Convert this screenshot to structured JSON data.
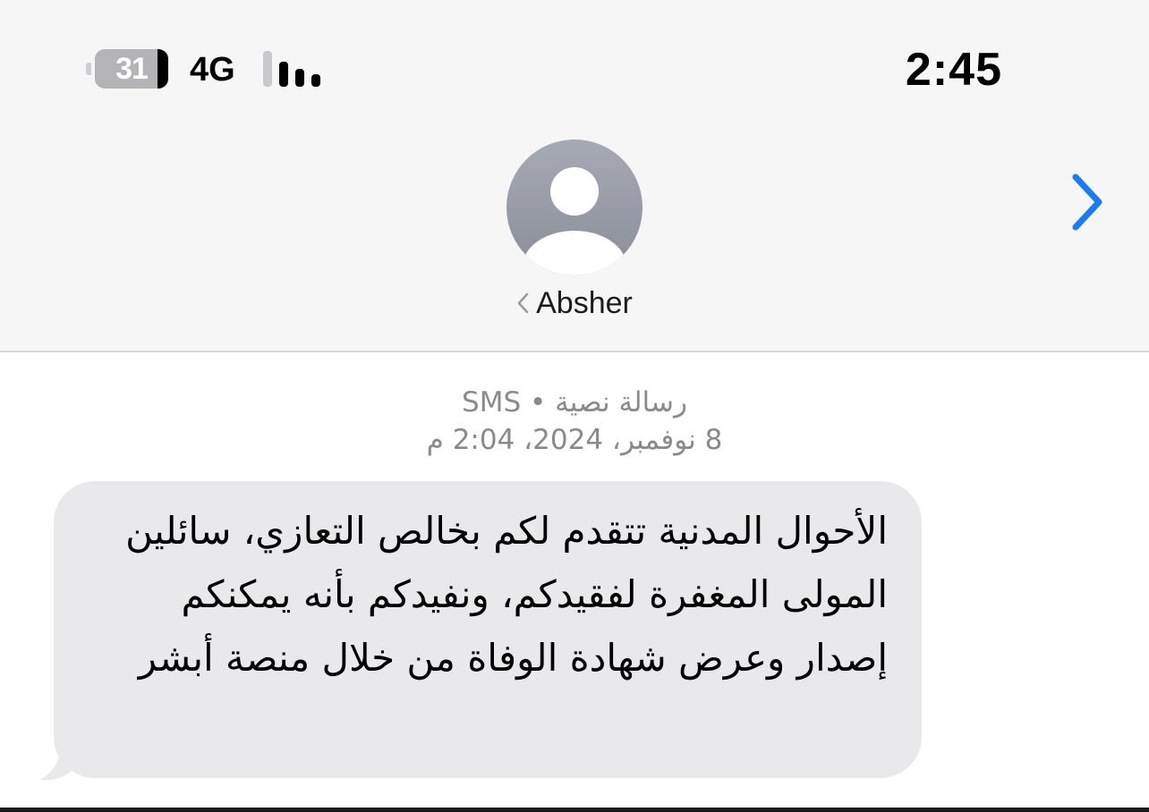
{
  "status_bar": {
    "battery_level": "31",
    "battery_fraction": 0.31,
    "network": "4G",
    "signal_bars_active": 3,
    "signal_bars_total": 4,
    "time": "2:45"
  },
  "header": {
    "contact_name": "Absher",
    "avatar_icon": "person-silhouette-icon",
    "details_icon": "chevron-right-icon",
    "back_icon": "chevron-left-icon"
  },
  "thread": {
    "message_type": "رسالة نصية • SMS",
    "timestamp": "8 نوفمبر، 2024، 2:04 م",
    "messages": [
      {
        "direction": "incoming",
        "text": "الأحوال المدنية تتقدم لكم بخالص التعازي، سائلين المولى المغفرة لفقيدكم، ونفيدكم بأنه يمكنكم إصدار وعرض شهادة الوفاة من خلال منصة أبشر"
      }
    ]
  },
  "colors": {
    "header_bg": "#f6f6f6",
    "accent": "#1a7cf5",
    "bubble_incoming": "#e9e9eb",
    "meta_text": "#8a8a8e",
    "avatar_bg": "#a0a3ad"
  }
}
